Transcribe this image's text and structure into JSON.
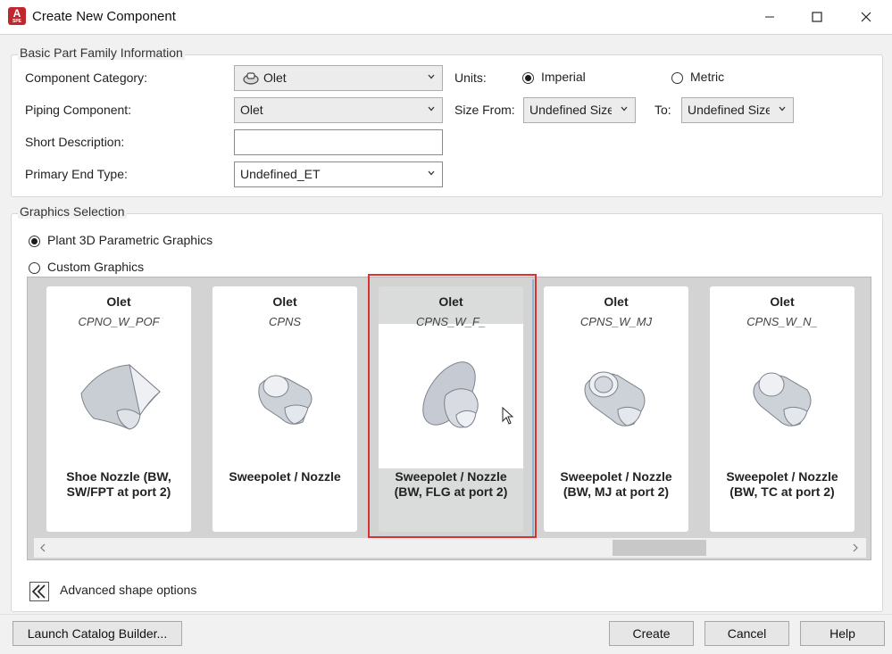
{
  "window": {
    "title": "Create New Component",
    "app_icon_letter": "A",
    "app_icon_sub": "SPE"
  },
  "basic_info": {
    "group_title": "Basic Part Family Information",
    "component_category_label": "Component Category:",
    "component_category_value": "Olet",
    "piping_component_label": "Piping Component:",
    "piping_component_value": "Olet",
    "short_description_label": "Short Description:",
    "short_description_value": "",
    "primary_end_type_label": "Primary End Type:",
    "primary_end_type_value": "Undefined_ET",
    "units_label": "Units:",
    "units_imperial": "Imperial",
    "units_metric": "Metric",
    "units_selected": "Imperial",
    "size_from_label": "Size From:",
    "size_from_value": "Undefined Size",
    "to_label": "To:",
    "to_value": "Undefined Size"
  },
  "graphics": {
    "group_title": "Graphics Selection",
    "parametric_label": "Plant 3D Parametric Graphics",
    "custom_label": "Custom Graphics",
    "selected_option": "Plant 3D Parametric Graphics",
    "cards": [
      {
        "title": "Olet",
        "code": "CPNO_W_POF",
        "name_line1": "Shoe Nozzle (BW,",
        "name_line2": "SW/FPT at port 2)",
        "icon": "shoe-nozzle-icon"
      },
      {
        "title": "Olet",
        "code": "CPNS",
        "name_line1": "Sweepolet / Nozzle",
        "name_line2": "",
        "icon": "sweepolet-icon"
      },
      {
        "title": "Olet",
        "code": "CPNS_W_F_",
        "name_line1": "Sweepolet / Nozzle",
        "name_line2": "(BW, FLG at port 2)",
        "icon": "flanged-sweepolet-icon",
        "selected": true
      },
      {
        "title": "Olet",
        "code": "CPNS_W_MJ",
        "name_line1": "Sweepolet / Nozzle",
        "name_line2": "(BW, MJ at port 2)",
        "icon": "mj-sweepolet-icon"
      },
      {
        "title": "Olet",
        "code": "CPNS_W_N_",
        "name_line1": "Sweepolet / Nozzle",
        "name_line2": "(BW, TC at port 2)",
        "icon": "tc-sweepolet-icon"
      }
    ],
    "scroll_position": 0.6,
    "advanced_label": "Advanced shape options"
  },
  "footer": {
    "launch_label": "Launch Catalog Builder...",
    "create_label": "Create",
    "cancel_label": "Cancel",
    "help_label": "Help"
  },
  "colors": {
    "selection_outline": "#d93232",
    "brand": "#c0272d"
  }
}
